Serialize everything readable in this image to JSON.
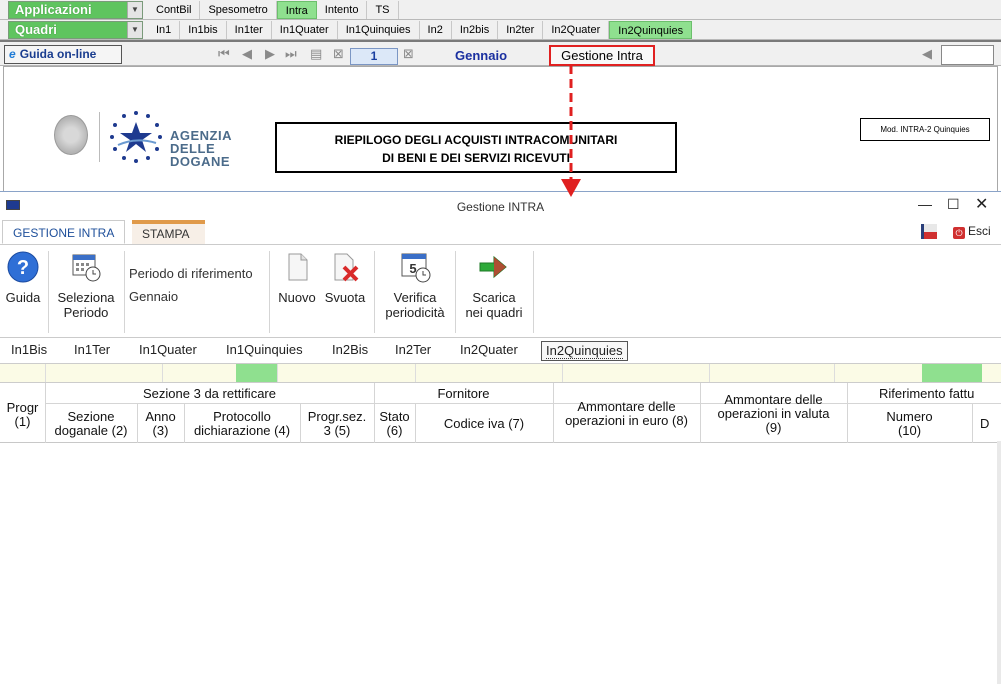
{
  "menu": {
    "applicazioni": "Applicazioni",
    "quadri": "Quadri",
    "row1_tabs": [
      "ContBil",
      "Spesometro",
      "Intra",
      "Intento",
      "TS"
    ],
    "row1_active": 2,
    "row2_tabs": [
      "In1",
      "In1bis",
      "In1ter",
      "In1Quater",
      "In1Quinquies",
      "In2",
      "In2bis",
      "In2ter",
      "In2Quater",
      "In2Quinquies"
    ],
    "row2_active": 9
  },
  "toolbar": {
    "guida_online": "Guida on-line",
    "page_number": "1",
    "month": "Gennaio",
    "gestione_intra": "Gestione Intra"
  },
  "document": {
    "logo_line1": "AGENZIA",
    "logo_line2": "DELLE",
    "logo_line3": "DOGANE",
    "title_line1": "RIEPILOGO DEGLI ACQUISTI INTRACOMUNITARI",
    "title_line2": "DI BENI E DEI SERVIZI RICEVUTI",
    "mod_label": "Mod. INTRA-2 Quinquies"
  },
  "dialog": {
    "title": "Gestione INTRA",
    "tab_gestione": "GESTIONE INTRA",
    "tab_stampa": "STAMPA",
    "esci": "Esci",
    "buttons": {
      "guida": "Guida",
      "seleziona_1": "Seleziona",
      "seleziona_2": "Periodo",
      "nuovo": "Nuovo",
      "svuota": "Svuota",
      "verifica_1": "Verifica",
      "verifica_2": "periodicità",
      "scarica_1": "Scarica",
      "scarica_2": "nei quadri"
    },
    "periodo_label": "Periodo di riferimento",
    "periodo_value": "Gennaio",
    "subtabs": [
      "In1Bis",
      "In1Ter",
      "In1Quater",
      "In1Quinquies",
      "In2Bis",
      "In2Ter",
      "In2Quater",
      "In2Quinquies"
    ],
    "subtab_active": 7
  },
  "grid": {
    "progr": "Progr",
    "progr_n": "(1)",
    "group_sezione3": "Sezione 3 da rettificare",
    "group_fornitore": "Fornitore",
    "group_riferimento": "Riferimento fattu",
    "sezione_doganale_1": "Sezione",
    "sezione_doganale_2": "doganale (2)",
    "anno_1": "Anno",
    "anno_2": "(3)",
    "protocollo_1": "Protocollo",
    "protocollo_2": "dichiarazione (4)",
    "progrsez_1": "Progr.sez.",
    "progrsez_2": "3 (5)",
    "stato_1": "Stato",
    "stato_2": "(6)",
    "codice_iva": "Codice iva (7)",
    "ammontare_euro_1": "Ammontare delle",
    "ammontare_euro_2": "operazioni in euro (8)",
    "ammontare_valuta_1": "Ammontare delle",
    "ammontare_valuta_2": "operazioni in valuta",
    "ammontare_valuta_3": "(9)",
    "numero_1": "Numero",
    "numero_2": "(10)",
    "d_cut": "D"
  },
  "colors": {
    "active_green": "#8fe08f",
    "highlight_red": "#e02020",
    "ribbon_blue": "#1e4f9a"
  }
}
